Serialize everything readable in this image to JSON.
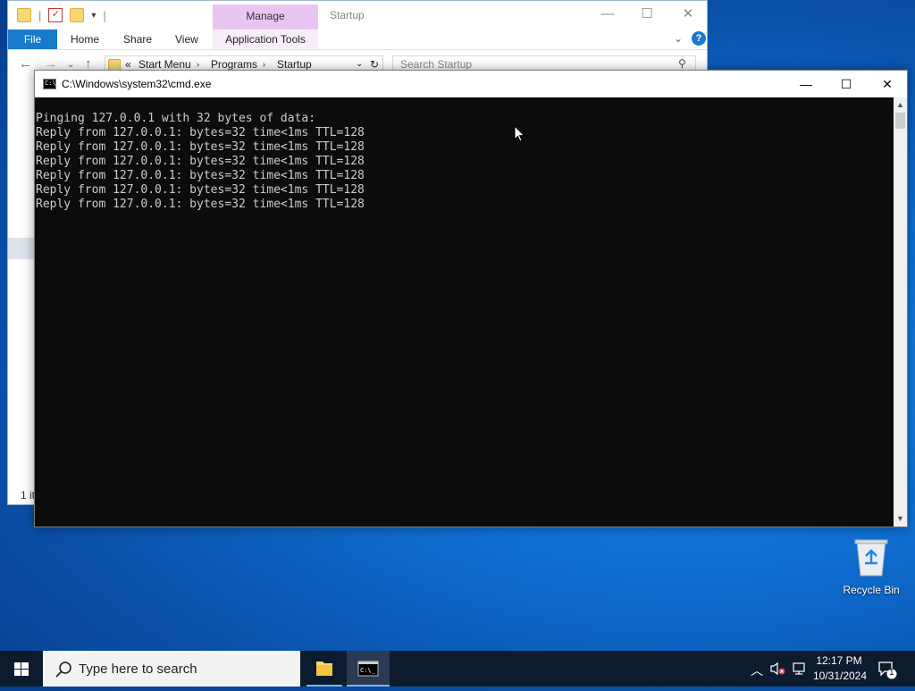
{
  "explorer": {
    "title": "Startup",
    "manage_tab": "Manage",
    "tabs": {
      "file": "File",
      "home": "Home",
      "share": "Share",
      "view": "View",
      "app_tools": "Application Tools"
    },
    "address": {
      "prefix": "«",
      "crumbs": [
        "Start Menu",
        "Programs",
        "Startup"
      ]
    },
    "search_placeholder": "Search Startup",
    "status": "1 it"
  },
  "cmd": {
    "title": "C:\\Windows\\system32\\cmd.exe",
    "lines": [
      "Pinging 127.0.0.1 with 32 bytes of data:",
      "Reply from 127.0.0.1: bytes=32 time<1ms TTL=128",
      "Reply from 127.0.0.1: bytes=32 time<1ms TTL=128",
      "Reply from 127.0.0.1: bytes=32 time<1ms TTL=128",
      "Reply from 127.0.0.1: bytes=32 time<1ms TTL=128",
      "Reply from 127.0.0.1: bytes=32 time<1ms TTL=128",
      "Reply from 127.0.0.1: bytes=32 time<1ms TTL=128"
    ]
  },
  "desktop": {
    "recycle_bin": "Recycle Bin"
  },
  "taskbar": {
    "search_placeholder": "Type here to search",
    "time": "12:17 PM",
    "date": "10/31/2024",
    "notification_count": "1"
  }
}
